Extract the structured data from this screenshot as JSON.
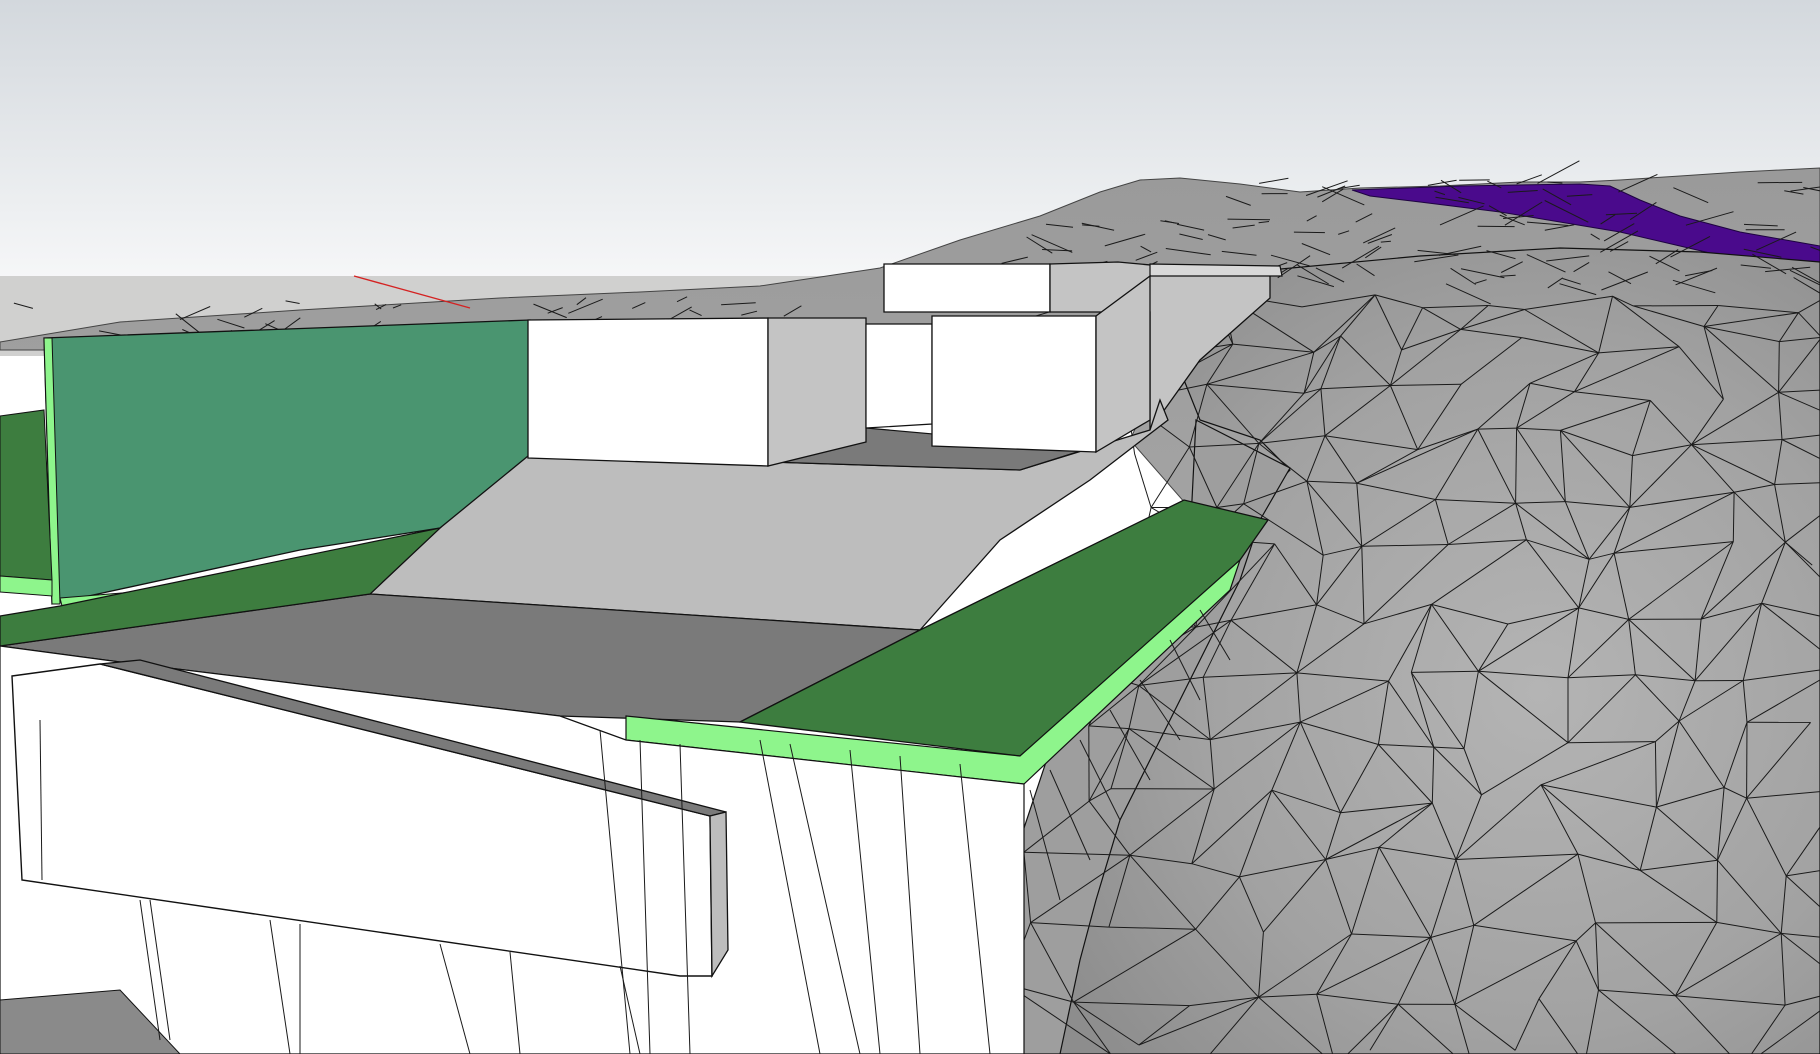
{
  "app": {
    "name": ""
  },
  "viewport": {
    "kind": "3d-model-view",
    "sky_top_color": "#d3d8dd",
    "sky_bottom_color": "#f6f7f8",
    "ground_color": "#d0d0cf"
  },
  "materials": {
    "terrain": "#a4a4a4",
    "terrain_edges": "#111111",
    "roof_green": "#3d7d3f",
    "light_green_fascia": "#8ef58c",
    "green_wall": "#4a9570",
    "white_face": "#ffffff",
    "gray_face": "#bdbdbd",
    "dark_gray_face": "#7a7a7a",
    "road_purple": "#4a0a8c",
    "red_axis": "#d42222"
  },
  "model_objects": [
    {
      "id": "terrain-mesh",
      "label": ""
    },
    {
      "id": "green-roof",
      "label": ""
    },
    {
      "id": "green-wall",
      "label": ""
    },
    {
      "id": "white-box-left",
      "label": ""
    },
    {
      "id": "white-box-right",
      "label": ""
    },
    {
      "id": "ramp",
      "label": ""
    },
    {
      "id": "cantilever-volume",
      "label": ""
    },
    {
      "id": "purple-road",
      "label": ""
    },
    {
      "id": "red-axis",
      "label": ""
    }
  ]
}
